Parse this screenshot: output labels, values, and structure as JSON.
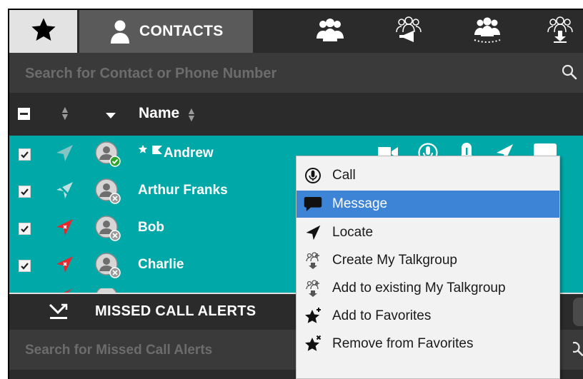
{
  "tabs": {
    "favorites_icon": "star-icon",
    "contacts_label": "CONTACTS",
    "group_icons": [
      "group-icon",
      "group-broadcast-icon",
      "group-dynamic-icon",
      "group-download-icon"
    ]
  },
  "search": {
    "placeholder": "Search for Contact or Phone Number"
  },
  "header": {
    "name_label": "Name"
  },
  "contacts": [
    {
      "name": "Andrew",
      "checked": true,
      "presence": "online",
      "favorite": true,
      "flagged": true
    },
    {
      "name": "Arthur Franks",
      "checked": true,
      "presence": "offline"
    },
    {
      "name": "Bob",
      "checked": true,
      "presence": "offline"
    },
    {
      "name": "Charlie",
      "checked": true,
      "presence": "offline"
    }
  ],
  "row_actions": [
    "video-icon",
    "ptt-call-icon",
    "alert-icon",
    "locate-icon",
    "message-icon"
  ],
  "context_menu": {
    "items": [
      {
        "label": "Call",
        "icon": "ptt-call-icon"
      },
      {
        "label": "Message",
        "icon": "message-icon",
        "selected": true
      },
      {
        "label": "Locate",
        "icon": "locate-icon"
      },
      {
        "label": "Create My Talkgroup",
        "icon": "talkgroup-icon"
      },
      {
        "label": "Add to existing My Talkgroup",
        "icon": "talkgroup-icon"
      },
      {
        "label": "Add to Favorites",
        "icon": "star-add-icon"
      },
      {
        "label": "Remove from Favorites",
        "icon": "star-remove-icon"
      }
    ]
  },
  "missed_calls": {
    "title": "MISSED CALL ALERTS",
    "search_placeholder": "Search for Missed Call Alerts"
  },
  "colors": {
    "list_bg": "#00a8a8",
    "menu_selected": "#3d84d6",
    "online": "#2aa52a",
    "dark_bg": "#2b2b2b"
  }
}
